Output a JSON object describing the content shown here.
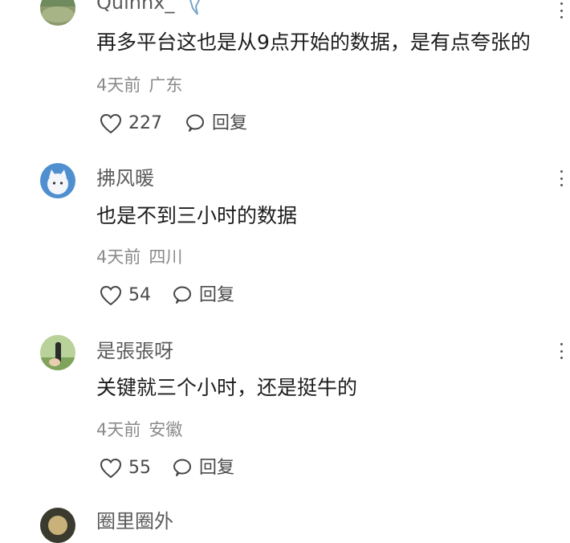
{
  "comments": [
    {
      "username": "Quinnx_",
      "text": "再多平台这也是从9点开始的数据，是有点夸张的",
      "time": "4天前",
      "location": "广东",
      "likes": "227",
      "reply_label": "回复"
    },
    {
      "username": "拂风暖",
      "text": "也是不到三小时的数据",
      "time": "4天前",
      "location": "四川",
      "likes": "54",
      "reply_label": "回复"
    },
    {
      "username": "是張張呀",
      "text": "关键就三个小时，还是挺牛的",
      "time": "4天前",
      "location": "安徽",
      "likes": "55",
      "reply_label": "回复"
    },
    {
      "username": "圈里圈外"
    }
  ],
  "icons": {
    "like": "heart-outline-icon",
    "reply": "speech-bubble-icon",
    "more": "more-vertical-icon"
  }
}
